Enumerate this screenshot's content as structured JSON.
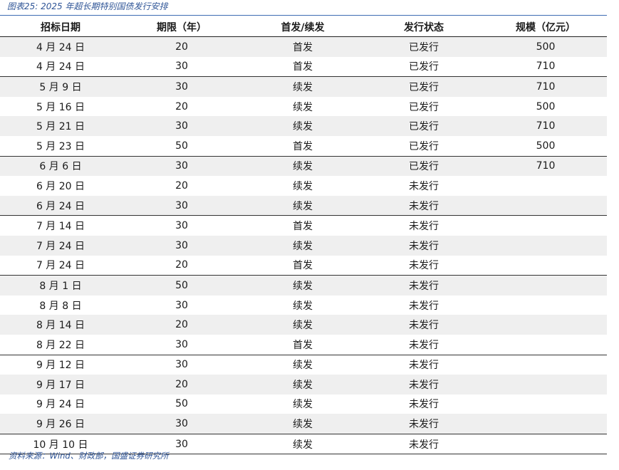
{
  "title": "图表25:  2025 年超长期特别国债发行安排",
  "headers": [
    "招标日期",
    "期限（年）",
    "首发/续发",
    "发行状态",
    "规模（亿元）"
  ],
  "rows": [
    [
      "4 月 24 日",
      "20",
      "首发",
      "已发行",
      "500"
    ],
    [
      "4 月 24 日",
      "30",
      "首发",
      "已发行",
      "710"
    ],
    [
      "5 月 9 日",
      "30",
      "续发",
      "已发行",
      "710"
    ],
    [
      "5 月 16 日",
      "20",
      "续发",
      "已发行",
      "500"
    ],
    [
      "5 月 21 日",
      "30",
      "续发",
      "已发行",
      "710"
    ],
    [
      "5 月 23 日",
      "50",
      "首发",
      "已发行",
      "500"
    ],
    [
      "6 月 6 日",
      "30",
      "续发",
      "已发行",
      "710"
    ],
    [
      "6 月 20 日",
      "20",
      "续发",
      "未发行",
      ""
    ],
    [
      "6 月 24 日",
      "30",
      "续发",
      "未发行",
      ""
    ],
    [
      "7 月 14 日",
      "30",
      "首发",
      "未发行",
      ""
    ],
    [
      "7 月 24 日",
      "30",
      "续发",
      "未发行",
      ""
    ],
    [
      "7 月 24 日",
      "20",
      "首发",
      "未发行",
      ""
    ],
    [
      "8 月 1 日",
      "50",
      "续发",
      "未发行",
      ""
    ],
    [
      "8 月 8 日",
      "30",
      "续发",
      "未发行",
      ""
    ],
    [
      "8 月 14 日",
      "20",
      "续发",
      "未发行",
      ""
    ],
    [
      "8 月 22 日",
      "30",
      "首发",
      "未发行",
      ""
    ],
    [
      "9 月 12 日",
      "30",
      "续发",
      "未发行",
      ""
    ],
    [
      "9 月 17 日",
      "20",
      "续发",
      "未发行",
      ""
    ],
    [
      "9 月 24 日",
      "50",
      "续发",
      "未发行",
      ""
    ],
    [
      "9 月 26 日",
      "30",
      "续发",
      "未发行",
      ""
    ],
    [
      "10 月 10 日",
      "30",
      "续发",
      "未发行",
      ""
    ]
  ],
  "source": "资料来源：Wind、财政部，国盛证券研究所"
}
